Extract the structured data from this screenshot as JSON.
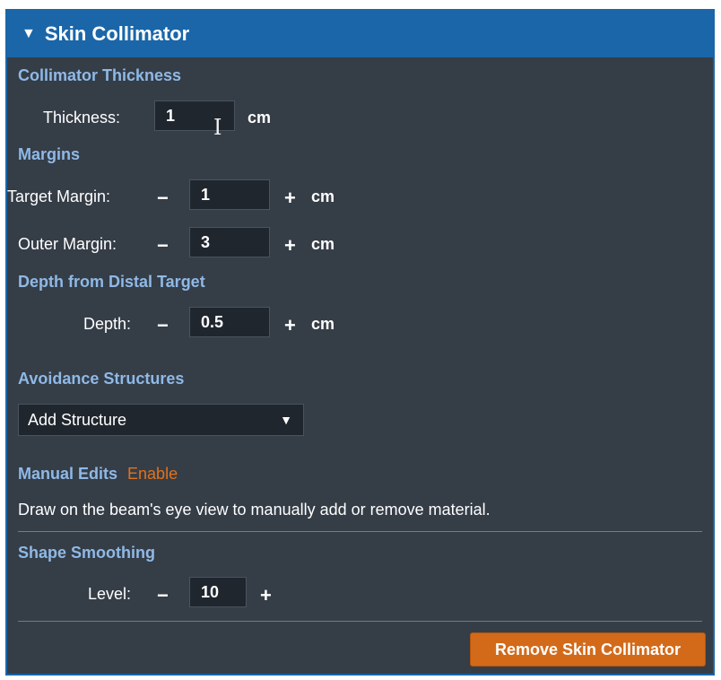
{
  "panel": {
    "title": "Skin Collimator",
    "collimator_thickness": {
      "heading": "Collimator Thickness",
      "thickness_label": "Thickness:",
      "thickness_value": "1",
      "unit": "cm"
    },
    "margins": {
      "heading": "Margins",
      "target_label": "Target Margin:",
      "target_value": "1",
      "outer_label": "Outer Margin:",
      "outer_value": "3",
      "unit": "cm"
    },
    "depth": {
      "heading": "Depth from Distal Target",
      "label": "Depth:",
      "value": "0.5",
      "unit": "cm"
    },
    "avoidance": {
      "heading": "Avoidance Structures",
      "select_value": "Add Structure"
    },
    "manual_edits": {
      "heading": "Manual Edits",
      "enable_link": "Enable",
      "description": "Draw on the beam's eye view to manually add or remove material."
    },
    "shape_smoothing": {
      "heading": "Shape Smoothing",
      "level_label": "Level:",
      "level_value": "10"
    },
    "remove_button": "Remove Skin Collimator"
  },
  "colors": {
    "header_bg": "#1a66a8",
    "panel_bg": "#353d47",
    "section_heading": "#8fb9e6",
    "accent_orange": "#d36a1a"
  }
}
